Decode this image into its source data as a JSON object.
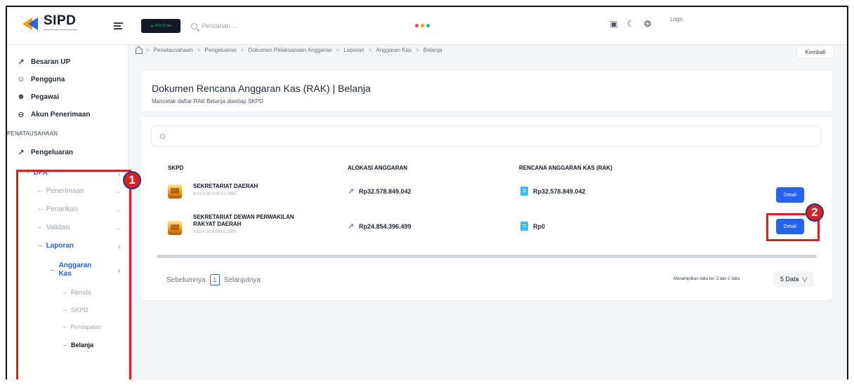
{
  "app": {
    "logo_text": "SIPD",
    "chip_text": "▲ 970.72 ms",
    "search_placeholder": "Pencarian....",
    "status_dot_colors": [
      "#ef4444",
      "#f59e0b",
      "#22c55e"
    ],
    "avatar_alt": "Logo",
    "top_icons": [
      "layout-icon",
      "moon-icon",
      "settings-icon"
    ]
  },
  "sidebar": {
    "items": [
      {
        "label": "Besaran UP",
        "icon": "arrows-expand-icon"
      },
      {
        "label": "Pengguna",
        "icon": "user-icon"
      },
      {
        "label": "Pegawai",
        "icon": "users-icon"
      },
      {
        "label": "Akun Penerimaan",
        "icon": "circle-minus-icon"
      }
    ],
    "section_label": "PENATAUSAHAAN",
    "pengeluaran_label": "Pengeluaran",
    "dpa_label": "DPA",
    "submenu": [
      "Penerimaan",
      "Penarikan",
      "Validasi",
      "Laporan"
    ],
    "anggaran_kas_label": "Anggaran Kas",
    "leaf_items": [
      "Pemda",
      "SKPD",
      "Pendapatan",
      "Belanja"
    ]
  },
  "breadcrumb": [
    "Penatausahaan",
    "Pengeluaran",
    "Dokumen Pelaksanaan Anggaran",
    "Laporan",
    "Anggaran Kas",
    "Belanja"
  ],
  "back_label": "Kembali",
  "header": {
    "title": "Dokumen Rencana Anggaran Kas (RAK) | Belanja",
    "subtitle": "Mancetak daftar RAK Belanja disetiap SKPD"
  },
  "table": {
    "columns": [
      "SKPD",
      "ALOKASI ANGGARAN",
      "RENCANA ANGGARAN KAS (RAK)"
    ],
    "rows": [
      {
        "name": "SEKRETARIAT DAERAH",
        "code": "4.01.0.00.0.00.01.0000",
        "alokasi": "Rp32.578.849.042",
        "rak": "Rp32.578.849.042",
        "action": "Detail"
      },
      {
        "name": "SEKRETARIAT DEWAN PERWAKILAN RAKYAT DAERAH",
        "code": "4.02.4.02.4.03.01.0000",
        "alokasi": "Rp24.854.396.499",
        "rak": "Rp0",
        "action": "Detail"
      }
    ]
  },
  "pagination": {
    "prev": "Sebelumnya",
    "current": "1",
    "next": "Selanjutnya",
    "showing": "Menampilkan data ke- 2 dari 2 data",
    "per_page": "5 Data"
  },
  "annotations": {
    "box1": "1",
    "box2": "2",
    "color": "#e11d1d"
  }
}
